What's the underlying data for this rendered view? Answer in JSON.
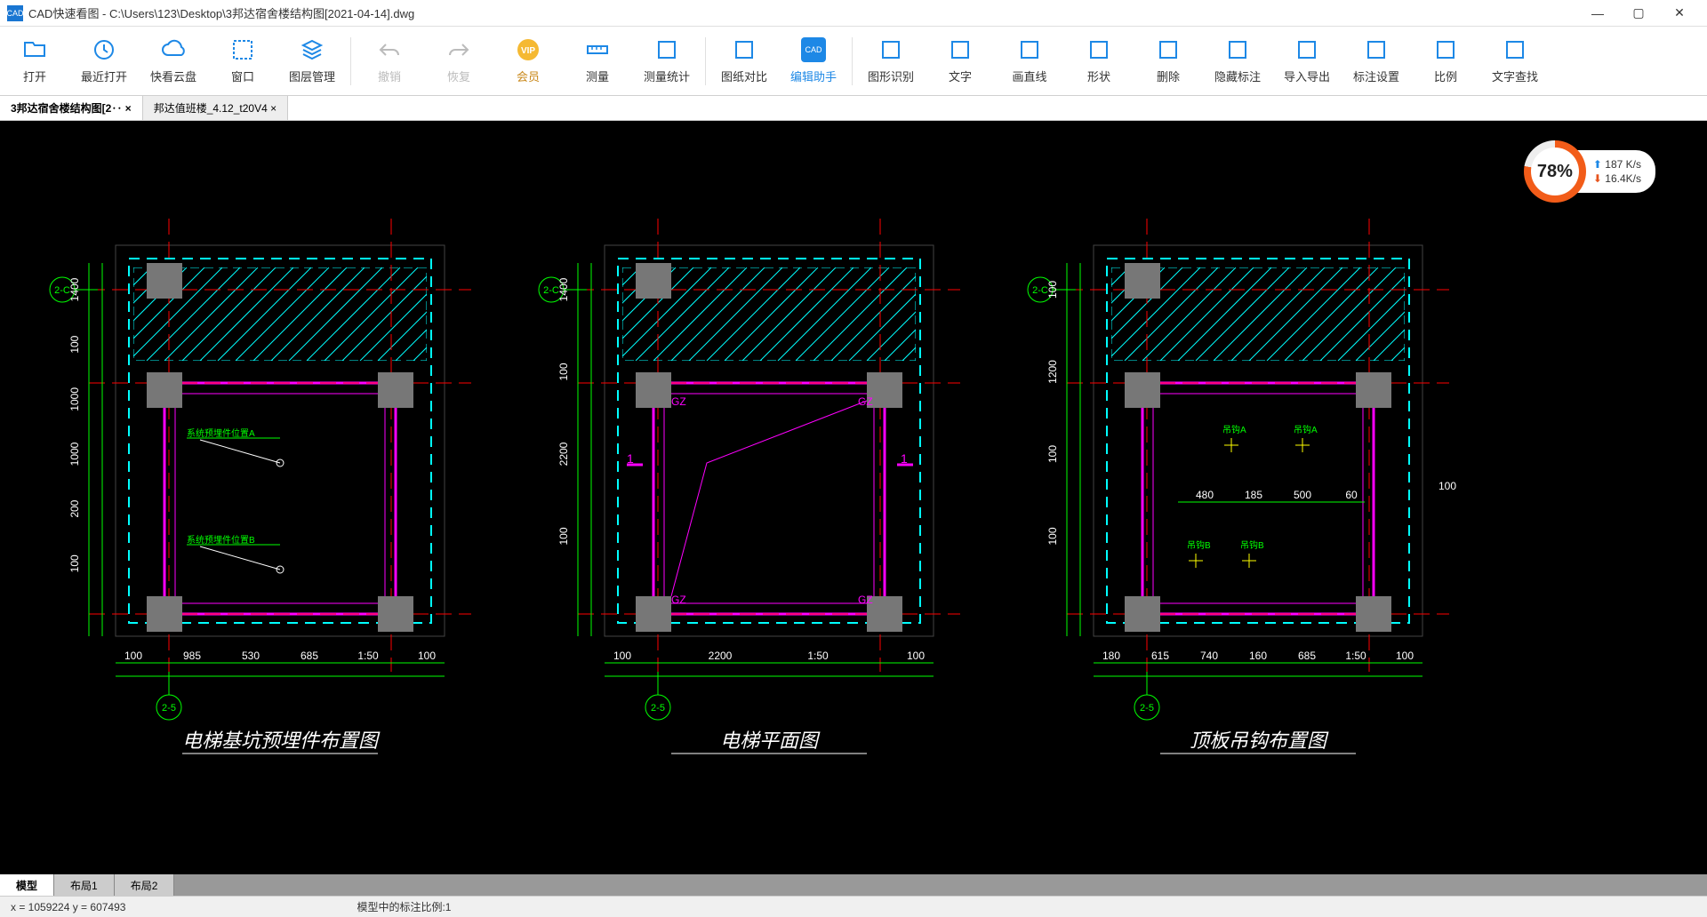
{
  "title": "CAD快速看图 - C:\\Users\\123\\Desktop\\3邦达宿舍楼结构图[2021-04-14].dwg",
  "toolbar": [
    {
      "id": "open",
      "label": "打开",
      "color": "#1d88e6"
    },
    {
      "id": "recent",
      "label": "最近打开",
      "color": "#1d88e6"
    },
    {
      "id": "cloud",
      "label": "快看云盘",
      "color": "#1d88e6"
    },
    {
      "id": "window",
      "label": "窗口",
      "color": "#1d88e6"
    },
    {
      "id": "layer",
      "label": "图层管理",
      "color": "#1d88e6"
    },
    {
      "id": "sep"
    },
    {
      "id": "undo",
      "label": "撤销",
      "disabled": true
    },
    {
      "id": "redo",
      "label": "恢复",
      "disabled": true
    },
    {
      "id": "vip",
      "label": "会员",
      "vip": true
    },
    {
      "id": "measure",
      "label": "测量",
      "color": "#1d88e6"
    },
    {
      "id": "measure-stat",
      "label": "测量统计",
      "color": "#1d88e6"
    },
    {
      "id": "sep"
    },
    {
      "id": "compare",
      "label": "图纸对比",
      "color": "#1d88e6"
    },
    {
      "id": "edit-assist",
      "label": "编辑助手",
      "edit": true
    },
    {
      "id": "sep"
    },
    {
      "id": "shape-detect",
      "label": "图形识别",
      "color": "#1d88e6"
    },
    {
      "id": "text",
      "label": "文字",
      "color": "#1d88e6"
    },
    {
      "id": "line",
      "label": "画直线",
      "color": "#1d88e6"
    },
    {
      "id": "shape",
      "label": "形状",
      "color": "#1d88e6"
    },
    {
      "id": "delete",
      "label": "删除",
      "color": "#1d88e6"
    },
    {
      "id": "hide-anno",
      "label": "隐藏标注",
      "color": "#1d88e6"
    },
    {
      "id": "import-export",
      "label": "导入导出",
      "color": "#1d88e6"
    },
    {
      "id": "anno-settings",
      "label": "标注设置",
      "color": "#1d88e6"
    },
    {
      "id": "ratio",
      "label": "比例",
      "color": "#1d88e6"
    },
    {
      "id": "find-text",
      "label": "文字查找",
      "color": "#1d88e6"
    }
  ],
  "file_tabs": [
    {
      "label": "3邦达宿舍楼结构图[2‥ ×",
      "active": true
    },
    {
      "label": "邦达值班楼_4.12_t20V4 ×",
      "active": false
    }
  ],
  "net": {
    "pct": "78%",
    "up": "187 K/s",
    "down": "16.4K/s"
  },
  "drawings": [
    {
      "title": "电梯基坑预埋件布置图",
      "grid_top": "2-C",
      "grid_bottom": "2-5",
      "dims_left": [
        "1400",
        "100",
        "1000",
        "1000",
        "200",
        "100"
      ],
      "dims_bottom": [
        "100",
        "985",
        "530",
        "685",
        "1:50",
        "100"
      ],
      "annots": [
        "系统预埋件位置A",
        "系统预埋件位置B"
      ]
    },
    {
      "title": "电梯平面图",
      "grid_top": "2-C",
      "grid_bottom": "2-5",
      "dims_left": [
        "1400",
        "100",
        "2200",
        "100"
      ],
      "dims_bottom": [
        "100",
        "2200",
        "1:50",
        "100"
      ],
      "gz": [
        "GZ",
        "GZ",
        "GZ",
        "GZ"
      ],
      "sections": [
        "1",
        "1"
      ]
    },
    {
      "title": "顶板吊钩布置图",
      "grid_top": "2-C",
      "grid_bottom": "2-5",
      "dims_left": [
        "100",
        "1200",
        "100",
        "100"
      ],
      "dims_right": [
        "100"
      ],
      "dims_mid": [
        "480",
        "185",
        "500",
        "60"
      ],
      "dims_bottom": [
        "180",
        "615",
        "740",
        "160",
        "685",
        "1:50",
        "100"
      ],
      "hooks": [
        "吊钩A",
        "吊钩A",
        "吊钩B",
        "吊钩B"
      ]
    }
  ],
  "layout_tabs": [
    "模型",
    "布局1",
    "布局2"
  ],
  "status": {
    "coord": "x = 1059224  y = 607493",
    "anno": "模型中的标注比例:1"
  }
}
